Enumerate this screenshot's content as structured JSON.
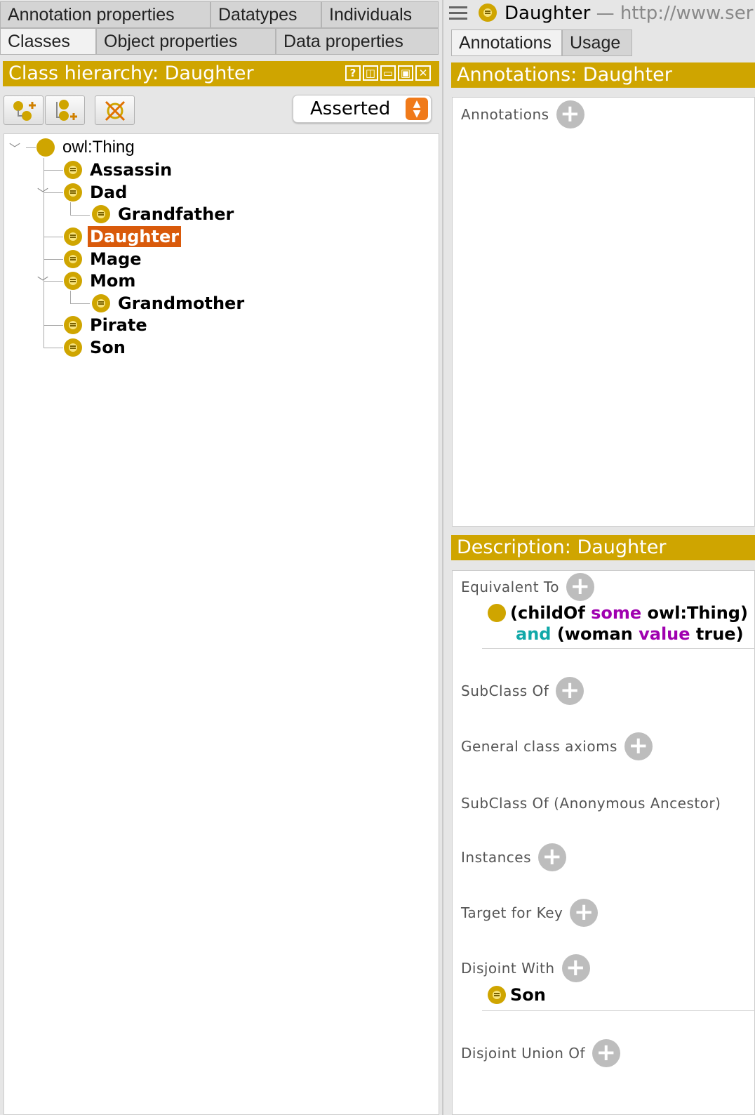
{
  "left_tabs_row1": [
    "Annotation properties",
    "Datatypes",
    "Individuals"
  ],
  "left_tabs_row2": [
    "Classes",
    "Object properties",
    "Data properties"
  ],
  "hierarchy": {
    "title": "Class hierarchy: Daughter",
    "view_buttons": [
      "?",
      "◫",
      "▭",
      "▣",
      "✕"
    ],
    "mode": "Asserted",
    "root": "owl:Thing",
    "nodes": [
      "Assassin",
      "Dad",
      "Grandfather",
      "Daughter",
      "Mage",
      "Mom",
      "Grandmother",
      "Pirate",
      "Son"
    ],
    "selected": "Daughter"
  },
  "header": {
    "entity": "Daughter",
    "iri": "— http://www.ser"
  },
  "right_tabs": [
    "Annotations",
    "Usage"
  ],
  "annotations": {
    "title": "Annotations: Daughter",
    "section": "Annotations"
  },
  "description": {
    "title": "Description: Daughter",
    "equivalent_to": "Equivalent To",
    "expr": {
      "open": "(childOf",
      "some": "some",
      "thing": "owl:Thing)",
      "and": "and",
      "woman": "(woman",
      "value": "value",
      "true": "true)"
    },
    "subclass_of": "SubClass Of",
    "general_axioms": "General class axioms",
    "anon_ancestor": "SubClass Of (Anonymous Ancestor)",
    "instances": "Instances",
    "target_key": "Target for Key",
    "disjoint_with": "Disjoint With",
    "disjoint_item": "Son",
    "disjoint_union": "Disjoint Union Of"
  },
  "colors": {
    "gold": "#cfa500",
    "selected": "#d95a0b",
    "purple": "#a000b0",
    "teal": "#10a8a8"
  }
}
